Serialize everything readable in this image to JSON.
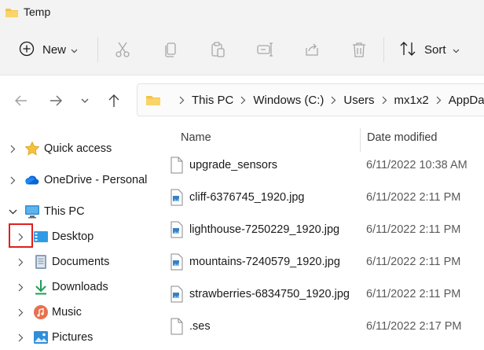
{
  "window": {
    "title": "Temp"
  },
  "toolbar": {
    "new_label": "New",
    "sort_label": "Sort",
    "icons": [
      "cut-icon",
      "copy-icon",
      "paste-icon",
      "rename-icon",
      "share-icon",
      "delete-icon"
    ]
  },
  "address": {
    "crumbs": [
      "This PC",
      "Windows (C:)",
      "Users",
      "mx1x2",
      "AppData"
    ]
  },
  "nav": {
    "items": [
      {
        "label": "Quick access",
        "icon": "star-icon"
      },
      {
        "label": "OneDrive - Personal",
        "icon": "cloud-icon"
      },
      {
        "label": "This PC",
        "icon": "computer-icon"
      },
      {
        "label": "Desktop",
        "icon": "desktop-icon"
      },
      {
        "label": "Documents",
        "icon": "documents-icon"
      },
      {
        "label": "Downloads",
        "icon": "download-icon"
      },
      {
        "label": "Music",
        "icon": "music-icon"
      },
      {
        "label": "Pictures",
        "icon": "pictures-icon"
      }
    ]
  },
  "files": {
    "columns": {
      "name": "Name",
      "date": "Date modified"
    },
    "rows": [
      {
        "name": "upgrade_sensors",
        "date": "6/11/2022 10:38 AM",
        "type": "file"
      },
      {
        "name": "cliff-6376745_1920.jpg",
        "date": "6/11/2022 2:11 PM",
        "type": "image"
      },
      {
        "name": "lighthouse-7250229_1920.jpg",
        "date": "6/11/2022 2:11 PM",
        "type": "image"
      },
      {
        "name": "mountains-7240579_1920.jpg",
        "date": "6/11/2022 2:11 PM",
        "type": "image"
      },
      {
        "name": "strawberries-6834750_1920.jpg",
        "date": "6/11/2022 2:11 PM",
        "type": "image"
      },
      {
        "name": ".ses",
        "date": "6/11/2022 2:17 PM",
        "type": "file"
      }
    ]
  },
  "colors": {
    "accent": "#0067c0",
    "folder": "#f5c342",
    "highlight": "#e01f1f"
  }
}
